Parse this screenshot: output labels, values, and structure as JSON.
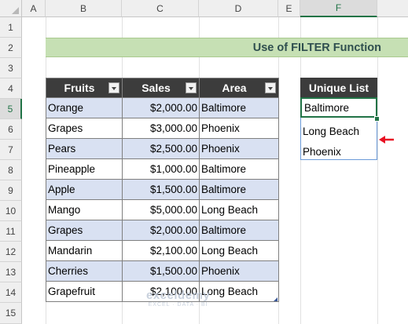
{
  "columns": [
    "A",
    "B",
    "C",
    "D",
    "E",
    "F"
  ],
  "selected_column": "F",
  "rows": [
    "1",
    "2",
    "3",
    "4",
    "5",
    "6",
    "7",
    "8",
    "9",
    "10",
    "11",
    "12",
    "13",
    "14",
    "15"
  ],
  "selected_row": "5",
  "banner_title": "Use of FILTER Function",
  "table": {
    "headers": [
      "Fruits",
      "Sales",
      "Area"
    ],
    "rows": [
      {
        "fruit": "Orange",
        "sales": "$2,000.00",
        "area": "Baltimore"
      },
      {
        "fruit": "Grapes",
        "sales": "$3,000.00",
        "area": "Phoenix"
      },
      {
        "fruit": "Pears",
        "sales": "$2,500.00",
        "area": "Phoenix"
      },
      {
        "fruit": "Pineapple",
        "sales": "$1,000.00",
        "area": "Baltimore"
      },
      {
        "fruit": "Apple",
        "sales": "$1,500.00",
        "area": "Baltimore"
      },
      {
        "fruit": "Mango",
        "sales": "$5,000.00",
        "area": "Long Beach"
      },
      {
        "fruit": "Grapes",
        "sales": "$2,000.00",
        "area": "Baltimore"
      },
      {
        "fruit": "Mandarin",
        "sales": "$2,100.00",
        "area": "Long Beach"
      },
      {
        "fruit": "Cherries",
        "sales": "$1,500.00",
        "area": "Phoenix"
      },
      {
        "fruit": "Grapefruit",
        "sales": "$2,100.00",
        "area": "Long Beach"
      }
    ]
  },
  "unique_list": {
    "header": "Unique List",
    "values": [
      "Baltimore",
      "Long Beach",
      "Phoenix"
    ]
  },
  "watermark": {
    "brand": "exceldemy",
    "tagline": "EXCEL · DATA · BI"
  },
  "colors": {
    "accent": "#217346",
    "banner": "#c6e0b4",
    "header_fill": "#3c3c3c",
    "band": "#d9e1f2",
    "arrow": "#e81123"
  }
}
